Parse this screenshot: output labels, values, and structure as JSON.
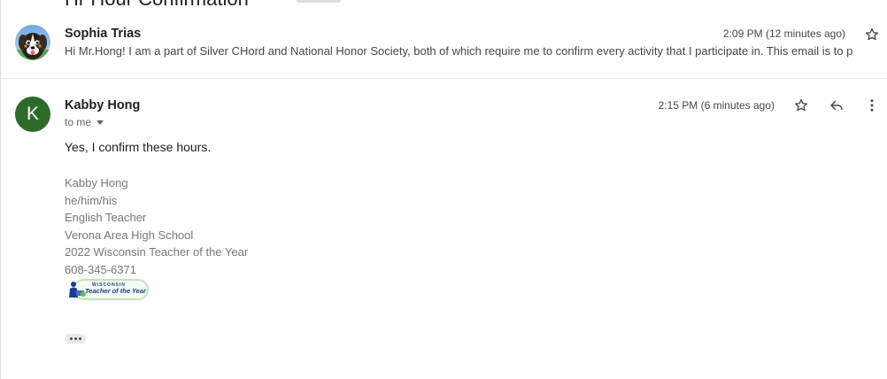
{
  "header": {
    "subject": "Hr Hour Confirmation"
  },
  "messages": [
    {
      "sender": "Sophia Trias",
      "time": "2:09 PM (12 minutes ago)",
      "snippet": "Hi Mr.Hong! I am a part of Silver CHord and National Honor Society, both of which require me to confirm every activity that I participate in. This email is to p"
    },
    {
      "sender": "Kabby Hong",
      "avatar_letter": "K",
      "time": "2:15 PM (6 minutes ago)",
      "recipient": "to me",
      "body": "Yes, I confirm these hours.",
      "signature": [
        "Kabby Hong",
        "he/him/his",
        "English Teacher",
        "Verona Area High School",
        "2022 Wisconsin Teacher of the Year",
        "608-345-6371"
      ],
      "signature_logo": {
        "state": "WISCONSIN",
        "title": "Teacher of the Year"
      }
    }
  ],
  "colors": {
    "avatar_k": "#2e6b2a",
    "signature_text": "#777777",
    "divider": "#e8eaed"
  },
  "icons": {
    "star": "star-icon",
    "reply": "reply-icon",
    "more": "more-vert-icon",
    "caret": "caret-down-icon",
    "ellipsis": "show-trimmed-content-icon"
  }
}
